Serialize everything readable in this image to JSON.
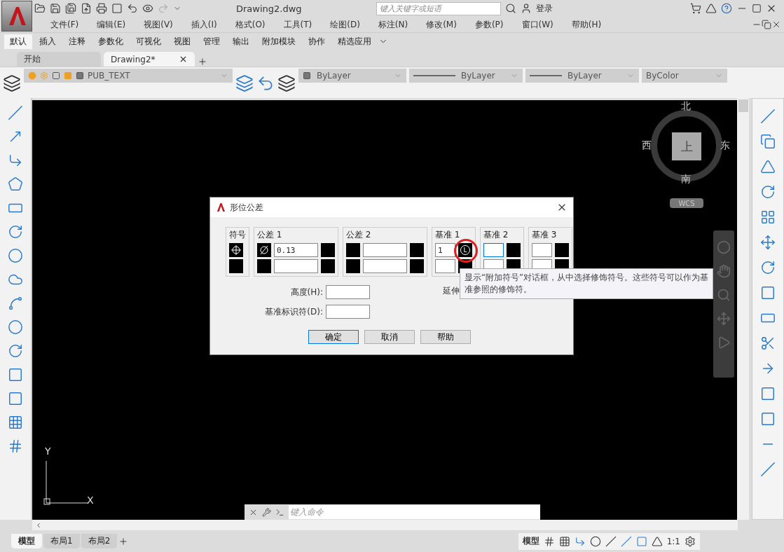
{
  "window": {
    "title": "Drawing2.dwg"
  },
  "search": {
    "placeholder": "键入关键字或短语"
  },
  "login": "登录",
  "menu": [
    "文件(F)",
    "编辑(E)",
    "视图(V)",
    "插入(I)",
    "格式(O)",
    "工具(T)",
    "绘图(D)",
    "标注(N)",
    "修改(M)",
    "参数(P)",
    "窗口(W)",
    "帮助(H)"
  ],
  "ribbon_tabs": [
    {
      "label": "默认",
      "selected": true
    },
    {
      "label": "插入",
      "selected": false
    },
    {
      "label": "注释",
      "selected": false
    },
    {
      "label": "参数化",
      "selected": false
    },
    {
      "label": "可视化",
      "selected": false
    },
    {
      "label": "视图",
      "selected": false
    },
    {
      "label": "管理",
      "selected": false
    },
    {
      "label": "输出",
      "selected": false
    },
    {
      "label": "附加模块",
      "selected": false
    },
    {
      "label": "协作",
      "selected": false
    },
    {
      "label": "精选应用",
      "selected": false
    }
  ],
  "doc_tabs": [
    {
      "label": "开始",
      "selected": false
    },
    {
      "label": "Drawing2*",
      "selected": true
    }
  ],
  "layer": "PUB_TEXT",
  "properties": [
    "ByLayer",
    "ByLayer",
    "ByLayer",
    "ByColor"
  ],
  "viewcube": {
    "north": "北",
    "west": "西",
    "east": "东",
    "south": "南",
    "face": "上",
    "wcs": "WCS"
  },
  "ucs": {
    "x": "X",
    "y": "Y"
  },
  "dialog": {
    "title": "形位公差",
    "headers": [
      "符号",
      "公差 1",
      "公差 2",
      "基准 1",
      "基准 2",
      "基准 3"
    ],
    "tolerance1": "0.13",
    "datum1": "1",
    "modifier": "L",
    "fields": [
      {
        "label": "高度(H):"
      },
      {
        "label": "基准标识符(D):"
      }
    ],
    "covered_label": "延伸",
    "buttons": [
      {
        "label": "确定",
        "default": true
      },
      {
        "label": "取消",
        "default": false
      },
      {
        "label": "帮助",
        "default": false
      }
    ]
  },
  "tooltip": "显示“附加符号”对话框，从中选择修饰符号。这些符号可以作为基准参照的修饰符。",
  "command": {
    "placeholder": "键入命令"
  },
  "layout_tabs": [
    {
      "label": "模型",
      "selected": true
    },
    {
      "label": "布局1",
      "selected": false
    },
    {
      "label": "布局2",
      "selected": false
    }
  ],
  "status": {
    "space": "模型",
    "scale": "1:1"
  }
}
